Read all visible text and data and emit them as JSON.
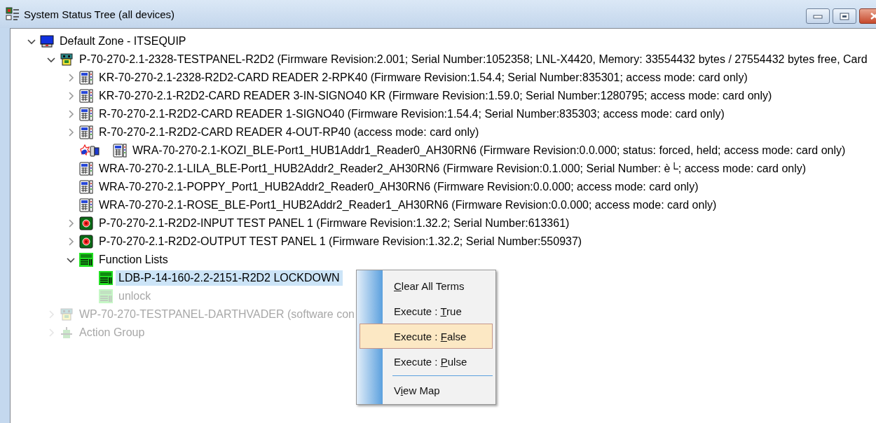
{
  "window": {
    "title": "System Status Tree (all devices)",
    "controls": [
      {
        "kind": "minimize"
      },
      {
        "kind": "maximize"
      },
      {
        "kind": "close"
      }
    ]
  },
  "tree": [
    {
      "label": "Default Zone - ITSEQUIP",
      "kind": "zone",
      "expanded": true,
      "selected": false,
      "dimmed": false,
      "children": [
        {
          "label": "P-70-270-2.1-2328-TESTPANEL-R2D2 (Firmware Revision:2.001; Serial Number:1052358; LNL-X4420, Memory: 33554432 bytes / 27554432 bytes free, Card",
          "kind": "panel",
          "expanded": true,
          "selected": false,
          "dimmed": false,
          "children": [
            {
              "label": "KR-70-270-2.1-2328-R2D2-CARD READER 2-RPK40 (Firmware Revision:1.54.4; Serial Number:835301; access mode: card only)",
              "kind": "reader",
              "expanded": false,
              "selected": false,
              "dimmed": false
            },
            {
              "label": "KR-70-270-2.1-R2D2-CARD READER 3-IN-SIGNO40 KR (Firmware Revision:1.59.0; Serial Number:1280795; access mode: card only)",
              "kind": "reader",
              "expanded": false,
              "selected": false,
              "dimmed": false
            },
            {
              "label": "R-70-270-2.1-R2D2-CARD READER 1-SIGNO40 (Firmware Revision:1.54.4; Serial Number:835303; access mode: card only)",
              "kind": "reader",
              "expanded": false,
              "selected": false,
              "dimmed": false
            },
            {
              "label": "R-70-270-2.1-R2D2-CARD READER 4-OUT-RP40 (access mode: card only)",
              "kind": "reader",
              "expanded": false,
              "selected": false,
              "dimmed": false
            },
            {
              "label": "WRA-70-270-2.1-KOZI_BLE-Port1_HUB1Addr1_Reader0_AH30RN6 (Firmware Revision:0.0.000; status: forced, held; access mode: card only)",
              "kind": "reader",
              "alert": true,
              "selected": false,
              "dimmed": false
            },
            {
              "label": "WRA-70-270-2.1-LILA_BLE-Port1_HUB2Addr2_Reader2_AH30RN6 (Firmware Revision:0.1.000; Serial Number: è└; access mode: card only)",
              "kind": "reader",
              "alert": false,
              "selected": false,
              "dimmed": false
            },
            {
              "label": "WRA-70-270-2.1-POPPY_Port1_HUB2Addr2_Reader0_AH30RN6 (Firmware Revision:0.0.000; access mode: card only)",
              "kind": "reader",
              "alert": false,
              "selected": false,
              "dimmed": false
            },
            {
              "label": "WRA-70-270-2.1-ROSE_BLE-Port1_HUB2Addr2_Reader1_AH30RN6 (Firmware Revision:0.0.000; access mode: card only)",
              "kind": "reader",
              "alert": false,
              "selected": false,
              "dimmed": false
            },
            {
              "label": "P-70-270-2.1-R2D2-INPUT TEST PANEL 1 (Firmware Revision:1.32.2; Serial Number:613361)",
              "kind": "io-panel",
              "expanded": false,
              "selected": false,
              "dimmed": false
            },
            {
              "label": "P-70-270-2.1-R2D2-OUTPUT TEST PANEL 1 (Firmware Revision:1.32.2; Serial Number:550937)",
              "kind": "io-panel",
              "expanded": false,
              "selected": false,
              "dimmed": false
            },
            {
              "label": "Function Lists",
              "kind": "function",
              "expanded": true,
              "selected": false,
              "dimmed": false,
              "children": [
                {
                  "label": "LDB-P-14-160-2.2-2151-R2D2 LOCKDOWN",
                  "kind": "function",
                  "selected": true,
                  "dimmed": false
                },
                {
                  "label": "unlock",
                  "kind": "function",
                  "selected": false,
                  "dimmed": true
                }
              ]
            }
          ]
        },
        {
          "label": "WP-70-270-TESTPANEL-DARTHVADER (software con",
          "kind": "panel",
          "expanded": false,
          "selected": false,
          "dimmed": true
        },
        {
          "label": "Action Group",
          "kind": "action-group",
          "expanded": false,
          "selected": false,
          "dimmed": true
        }
      ]
    }
  ],
  "context_menu": [
    {
      "kind": "item",
      "key": "C",
      "after": "lear All Terms",
      "selected": false
    },
    {
      "kind": "item",
      "before": "Execute : ",
      "key": "T",
      "after": "rue",
      "selected": false
    },
    {
      "kind": "item",
      "before": "Execute : ",
      "key": "F",
      "after": "alse",
      "selected": true
    },
    {
      "kind": "item",
      "before": "Execute : ",
      "key": "P",
      "after": "ulse",
      "selected": false
    },
    {
      "kind": "separator"
    },
    {
      "kind": "item",
      "before": "V",
      "key": "i",
      "after": "ew Map",
      "selected": false
    }
  ]
}
